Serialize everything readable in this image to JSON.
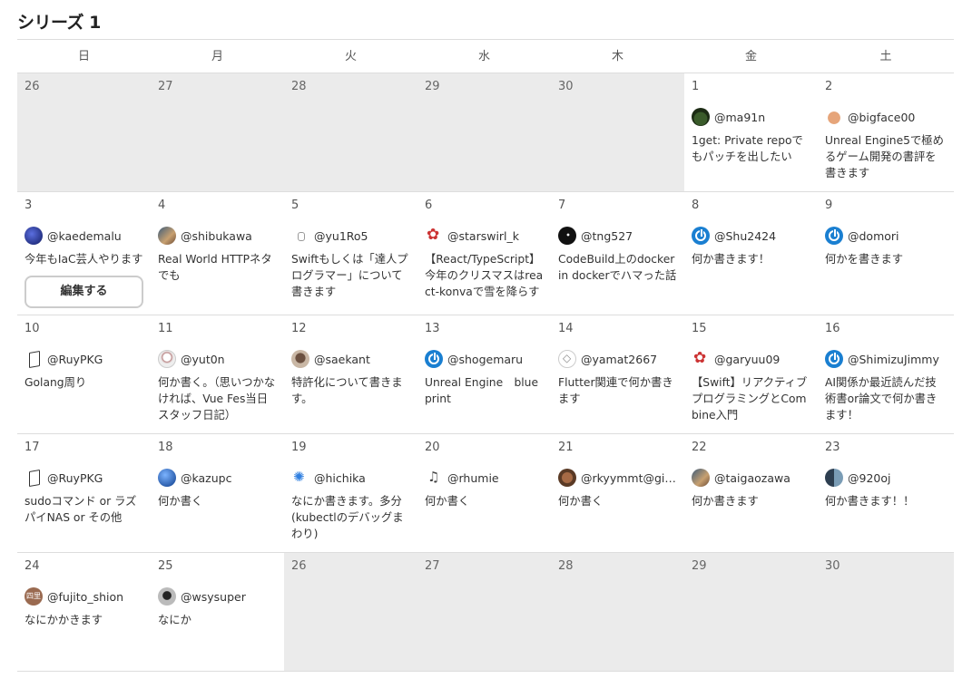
{
  "page": {
    "title": "シリーズ 1"
  },
  "calendar": {
    "weekdays": [
      "日",
      "月",
      "火",
      "水",
      "木",
      "金",
      "土"
    ],
    "weeks": [
      {
        "cells": [
          {
            "day": "26",
            "out": true
          },
          {
            "day": "27",
            "out": true
          },
          {
            "day": "28",
            "out": true
          },
          {
            "day": "29",
            "out": true
          },
          {
            "day": "30",
            "out": true
          },
          {
            "day": "1",
            "user": "@ma91n",
            "avatar_icon": "dark-landscape-avatar",
            "desc": "1get: Private repoでもパッチを出したい"
          },
          {
            "day": "2",
            "user": "@bigface00",
            "avatar_icon": "face-avatar",
            "desc": "Unreal Engine5で極めるゲーム開発の書評を書きます"
          }
        ]
      },
      {
        "cells": [
          {
            "day": "3",
            "user": "@kaedemalu",
            "avatar_icon": "blue-avatar",
            "desc": "今年もIaC芸人やります",
            "edit_button": "編集する"
          },
          {
            "day": "4",
            "user": "@shibukawa",
            "avatar_icon": "photo-avatar",
            "desc": "Real World HTTPネタでも"
          },
          {
            "day": "5",
            "user": "@yu1Ro5",
            "avatar_icon": "tiny-avatar",
            "desc": "Swiftもしくは「達人プログラマー」について書きます"
          },
          {
            "day": "6",
            "user": "@starswirl_k",
            "avatar_icon": "scratch-cat-avatar",
            "desc": "【React/TypeScript】今年のクリスマスはreact-konvaで雪を降らす"
          },
          {
            "day": "7",
            "user": "@tng527",
            "avatar_icon": "black-avatar",
            "desc": "CodeBuild上のdocker in dockerでハマった話"
          },
          {
            "day": "8",
            "user": "@Shu2424",
            "avatar_icon": "power-avatar",
            "desc": "何か書きます！"
          },
          {
            "day": "9",
            "user": "@domori",
            "avatar_icon": "power-avatar",
            "desc": "何かを書きます"
          }
        ]
      },
      {
        "cells": [
          {
            "day": "10",
            "user": "@RuyPKG",
            "avatar_icon": "book-avatar",
            "desc": "Golang周り"
          },
          {
            "day": "11",
            "user": "@yut0n",
            "avatar_icon": "sketch-avatar",
            "desc": "何か書く。（思いつかなければ、Vue Fes当日スタッフ日記）"
          },
          {
            "day": "12",
            "user": "@saekant",
            "avatar_icon": "person-avatar",
            "desc": "特許化について書きます。"
          },
          {
            "day": "13",
            "user": "@shogemaru",
            "avatar_icon": "power-avatar",
            "desc": "Unreal Engine　blueprint"
          },
          {
            "day": "14",
            "user": "@yamat2667",
            "avatar_icon": "ring-avatar",
            "desc": "Flutter関連で何か書きます"
          },
          {
            "day": "15",
            "user": "@garyuu09",
            "avatar_icon": "red-dragon-avatar",
            "desc": "【Swift】リアクティブプログラミングとCombine入門"
          },
          {
            "day": "16",
            "user": "@ShimizuJimmy",
            "avatar_icon": "power-avatar",
            "desc": "AI関係か最近読んだ技術書or論文で何か書きます！"
          }
        ]
      },
      {
        "cells": [
          {
            "day": "17",
            "user": "@RuyPKG",
            "avatar_icon": "book-avatar",
            "desc": "sudoコマンド or ラズパイNAS or その他"
          },
          {
            "day": "18",
            "user": "@kazupc",
            "avatar_icon": "globe-avatar",
            "desc": "何か書く"
          },
          {
            "day": "19",
            "user": "@hichika",
            "avatar_icon": "sprinkle-avatar",
            "desc": "なにか書きます。多分(kubectlのデバッグまわり)"
          },
          {
            "day": "20",
            "user": "@rhumie",
            "avatar_icon": "music-avatar",
            "desc": "何か書く"
          },
          {
            "day": "21",
            "user": "@rkyymmt@gith...",
            "avatar_icon": "brown-avatar",
            "desc": "何か書く"
          },
          {
            "day": "22",
            "user": "@taigaozawa",
            "avatar_icon": "photo-avatar",
            "desc": "何か書きます"
          },
          {
            "day": "23",
            "user": "@920oj",
            "avatar_icon": "pixel-avatar",
            "desc": "何か書きます！！"
          }
        ]
      },
      {
        "cells": [
          {
            "day": "24",
            "user": "@fujito_shion",
            "avatar_icon": "kanji-avatar",
            "desc": "なにかかきます"
          },
          {
            "day": "25",
            "user": "@wsysuper",
            "avatar_icon": "gray-avatar",
            "desc": "なにか"
          },
          {
            "day": "26",
            "out": true
          },
          {
            "day": "27",
            "out": true
          },
          {
            "day": "28",
            "out": true
          },
          {
            "day": "29",
            "out": true
          },
          {
            "day": "30",
            "out": true
          }
        ]
      }
    ]
  }
}
